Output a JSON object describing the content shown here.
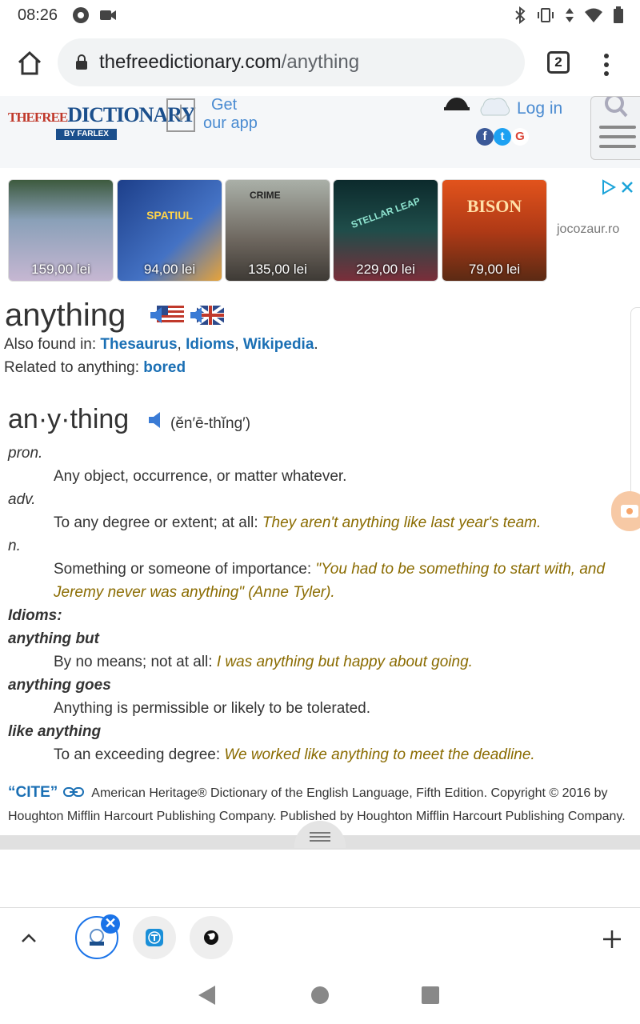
{
  "status_bar": {
    "time": "08:26"
  },
  "browser": {
    "url_domain": "thefreedictionary.com",
    "url_path": "/anything",
    "tab_count": "2"
  },
  "site_header": {
    "logo_text_1": "THEFREE",
    "logo_text_2": "DICTIONARY",
    "logo_text_3": "BY FARLEX",
    "get_app_line1": "Get",
    "get_app_line2": "our app",
    "login": "Log in",
    "social": [
      "f",
      "t",
      "G"
    ]
  },
  "ads": {
    "source": "jocozaur.ro",
    "items": [
      {
        "title": "",
        "price": "159,00 lei"
      },
      {
        "title": "SPATIUL",
        "price": "94,00 lei"
      },
      {
        "title": "CRIME",
        "price": "135,00 lei"
      },
      {
        "title": "STELLAR LEAP",
        "price": "229,00 lei"
      },
      {
        "title": "BISON",
        "price": "79,00 lei"
      }
    ]
  },
  "entry": {
    "word": "anything",
    "also_found_label": "Also found in: ",
    "also_found_links": [
      "Thesaurus",
      "Idioms",
      "Wikipedia"
    ],
    "related_label": "Related to anything: ",
    "related_link": "bored",
    "headword": "an·y·thing",
    "pronunciation": "(ĕn′ē-thĭng′)",
    "senses": [
      {
        "pos": "pron.",
        "def": "Any object, occurrence, or matter whatever.",
        "example": ""
      },
      {
        "pos": "adv.",
        "def": "To any degree or extent; at all: ",
        "example": "They aren't anything like last year's team."
      },
      {
        "pos": "n.",
        "def": "Something or someone of importance: ",
        "example": "\"You had to be something to start with, and Jeremy never was anything\" (Anne Tyler)."
      }
    ],
    "idioms_label": "Idioms:",
    "idioms": [
      {
        "phrase": "anything but",
        "def": "By no means; not at all: ",
        "example": "I was anything but happy about going."
      },
      {
        "phrase": "anything goes",
        "def": "Anything is permissible or likely to be tolerated.",
        "example": ""
      },
      {
        "phrase": "like anything",
        "def": "To an exceeding degree: ",
        "example": "We worked like anything to meet the deadline."
      }
    ],
    "cite_label": "“CITE”",
    "cite_text": "American Heritage® Dictionary of the English Language, Fifth Edition. Copyright © 2016 by Houghton Mifflin Harcourt Publishing Company. Published by Houghton Mifflin Harcourt Publishing Company. All rights reserved."
  },
  "colors": {
    "link": "#1a6fb4",
    "example": "#8a6b00",
    "accent": "#1a73e8"
  }
}
